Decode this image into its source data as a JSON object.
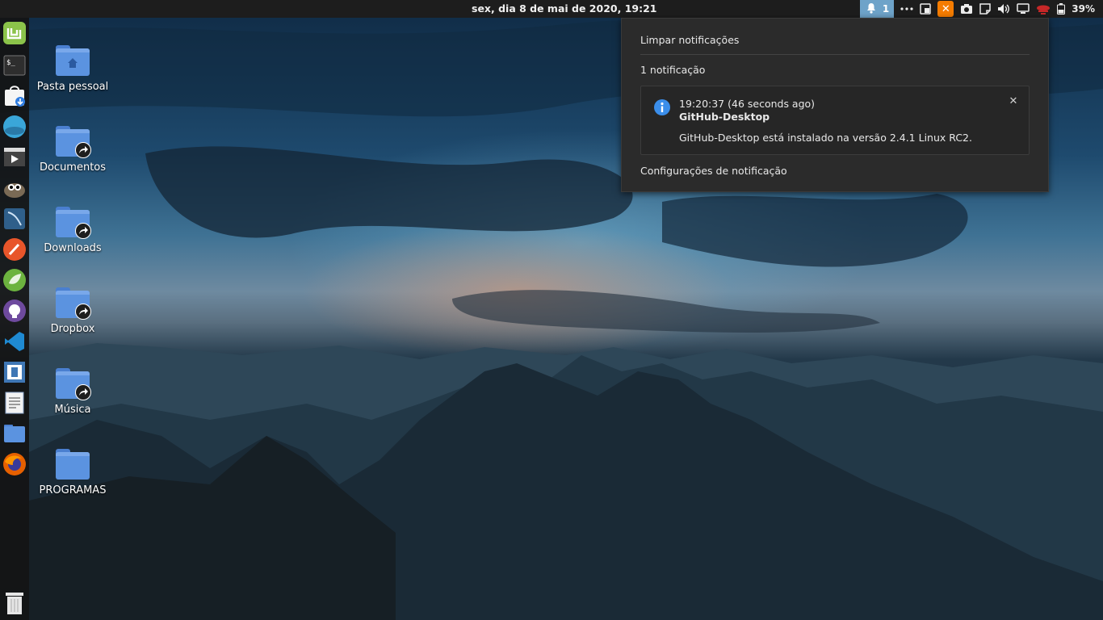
{
  "topbar": {
    "clock": "sex, dia  8 de mai de 2020, 19:21",
    "notification_count": "1",
    "xampp_label": "✕",
    "battery": "39%"
  },
  "dock": {
    "items": [
      {
        "name": "linux-mint-menu-icon",
        "color": "#8bc34a"
      },
      {
        "name": "terminal-icon",
        "color": "#2e2e2e"
      },
      {
        "name": "software-manager-icon",
        "color": "#f5f5f5"
      },
      {
        "name": "ubuntu-store-icon",
        "color": "#3aa6d8"
      },
      {
        "name": "video-editor-icon",
        "color": "#444"
      },
      {
        "name": "gimp-icon",
        "color": "#7a6a55"
      },
      {
        "name": "mysql-workbench-icon",
        "color": "#2f5f8a"
      },
      {
        "name": "pencil-app-icon",
        "color": "#e8552a"
      },
      {
        "name": "spring-tool-suite-icon",
        "color": "#6cb33f"
      },
      {
        "name": "github-desktop-icon",
        "color": "#6e4a9e"
      },
      {
        "name": "vscode-icon",
        "color": "#1f8ad2"
      },
      {
        "name": "system-monitor-icon",
        "color": "#3f77b5"
      },
      {
        "name": "text-editor-icon",
        "color": "#f2f2f2"
      },
      {
        "name": "files-icon",
        "color": "#5b93e0"
      },
      {
        "name": "firefox-icon",
        "color": "#e66000"
      },
      {
        "name": "trash-icon",
        "color": "#e6e6e6"
      }
    ]
  },
  "desktop": {
    "icons": [
      {
        "label": "Pasta pessoal",
        "badge": "home"
      },
      {
        "label": "Documentos",
        "badge": "link"
      },
      {
        "label": "Downloads",
        "badge": "link"
      },
      {
        "label": "Dropbox",
        "badge": "link"
      },
      {
        "label": "Música",
        "badge": "link"
      },
      {
        "label": "PROGRAMAS",
        "badge": "none"
      }
    ]
  },
  "notifications": {
    "clear_label": "Limpar notificações",
    "count_label": "1 notificação",
    "items": [
      {
        "time": "19:20:37 (46 seconds ago)",
        "app": "GitHub-Desktop",
        "message": "GitHub-Desktop está instalado na versão 2.4.1 Linux RC2."
      }
    ],
    "settings_label": "Configurações de notificação"
  }
}
